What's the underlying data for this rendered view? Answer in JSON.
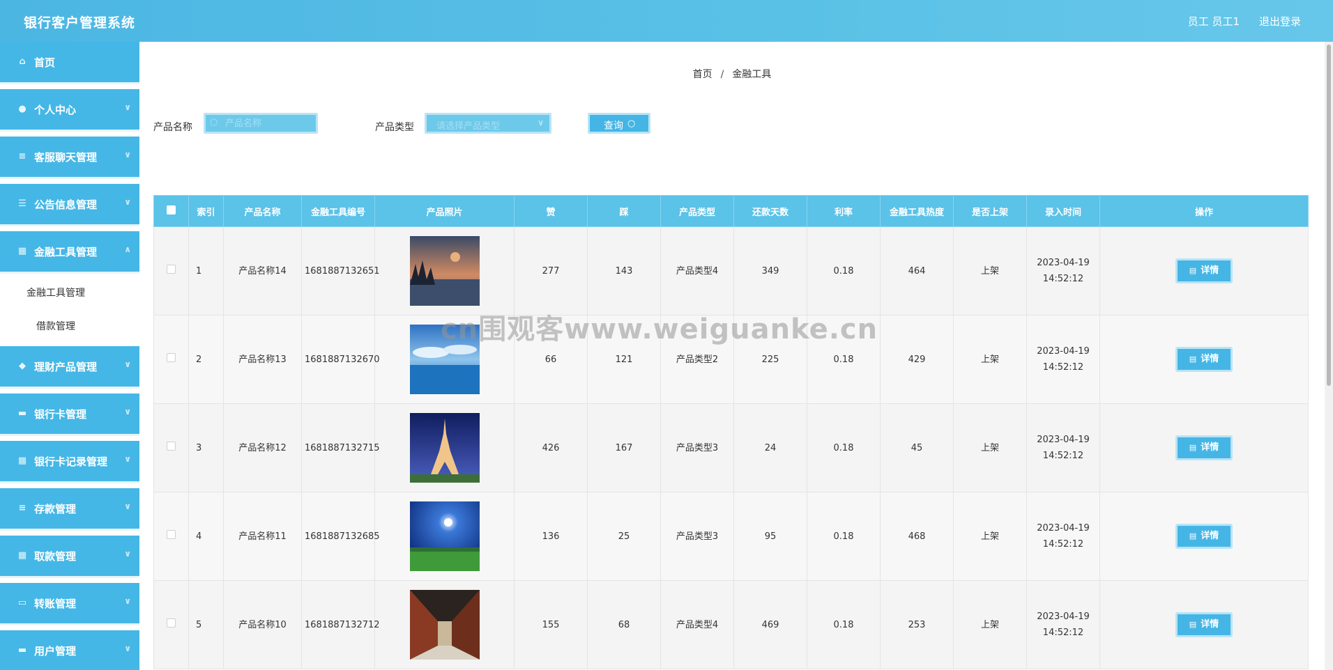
{
  "header": {
    "title": "银行客户管理系统",
    "user": "员工 员工1",
    "logout": "退出登录"
  },
  "sidebar": {
    "items": [
      {
        "label": "首页",
        "icon": "home-icon"
      },
      {
        "label": "个人中心",
        "icon": "user-icon"
      },
      {
        "label": "客服聊天管理",
        "icon": "list-icon"
      },
      {
        "label": "公告信息管理",
        "icon": "sliders-icon"
      },
      {
        "label": "金融工具管理",
        "icon": "grid-icon"
      },
      {
        "label": "理财产品管理",
        "icon": "finance-icon"
      },
      {
        "label": "银行卡管理",
        "icon": "card-icon"
      },
      {
        "label": "银行卡记录管理",
        "icon": "grid-icon"
      },
      {
        "label": "存款管理",
        "icon": "list-icon"
      },
      {
        "label": "取款管理",
        "icon": "grid-icon"
      },
      {
        "label": "转账管理",
        "icon": "monitor-icon"
      },
      {
        "label": "用户管理",
        "icon": "users-icon"
      }
    ],
    "subitems": [
      {
        "label": "金融工具管理"
      },
      {
        "label": "借款管理"
      }
    ]
  },
  "breadcrumb": {
    "home": "首页",
    "separator": "/",
    "current": "金融工具"
  },
  "filters": {
    "name_label": "产品名称",
    "name_placeholder": "产品名称",
    "type_label": "产品类型",
    "type_placeholder": "请选择产品类型",
    "query_label": "查询"
  },
  "table": {
    "columns": [
      "索引",
      "产品名称",
      "金融工具编号",
      "产品照片",
      "赞",
      "踩",
      "产品类型",
      "还款天数",
      "利率",
      "金融工具热度",
      "是否上架",
      "录入时间",
      "操作"
    ],
    "rows": [
      {
        "index": "1",
        "name": "产品名称14",
        "code": "1681887132651",
        "likes": "277",
        "dislikes": "143",
        "type": "产品类型4",
        "days": "349",
        "rate": "0.18",
        "heat": "464",
        "status": "上架",
        "time": "2023-04-19 14:52:12",
        "action": "详情",
        "photo": "lake-sunset"
      },
      {
        "index": "2",
        "name": "产品名称13",
        "code": "1681887132670",
        "likes": "66",
        "dislikes": "121",
        "type": "产品类型2",
        "days": "225",
        "rate": "0.18",
        "heat": "429",
        "status": "上架",
        "time": "2023-04-19 14:52:12",
        "action": "详情",
        "photo": "sea-clouds"
      },
      {
        "index": "3",
        "name": "产品名称12",
        "code": "1681887132715",
        "likes": "426",
        "dislikes": "167",
        "type": "产品类型3",
        "days": "24",
        "rate": "0.18",
        "heat": "45",
        "status": "上架",
        "time": "2023-04-19 14:52:12",
        "action": "详情",
        "photo": "eiffel-tower"
      },
      {
        "index": "4",
        "name": "产品名称11",
        "code": "1681887132685",
        "likes": "136",
        "dislikes": "25",
        "type": "产品类型3",
        "days": "95",
        "rate": "0.18",
        "heat": "468",
        "status": "上架",
        "time": "2023-04-19 14:52:12",
        "action": "详情",
        "photo": "moon-field"
      },
      {
        "index": "5",
        "name": "产品名称10",
        "code": "1681887132712",
        "likes": "155",
        "dislikes": "68",
        "type": "产品类型4",
        "days": "469",
        "rate": "0.18",
        "heat": "253",
        "status": "上架",
        "time": "2023-04-19 14:52:12",
        "action": "详情",
        "photo": "corridor"
      }
    ]
  },
  "watermark": "cn围观客www.weiguanke.cn",
  "colors": {
    "primary": "#45b7e6",
    "header": "#5ac1e6",
    "table_head": "#5bc2e8"
  }
}
